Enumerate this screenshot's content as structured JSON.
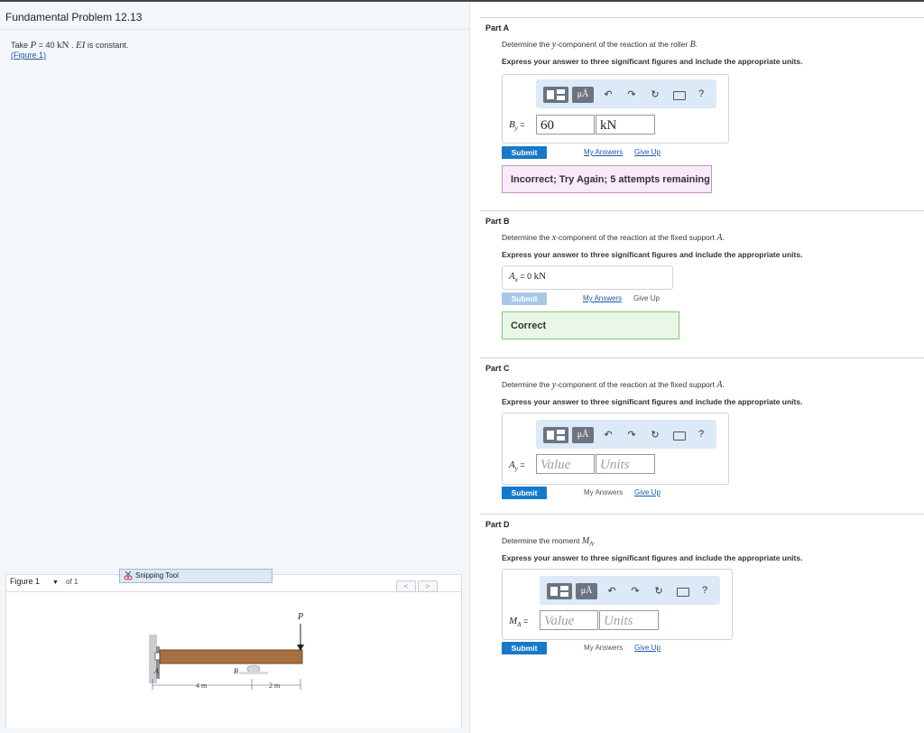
{
  "problem": {
    "title": "Fundamental Problem 12.13",
    "take": "Take",
    "p_var": "P",
    "p_eq": " = 40 ",
    "p_unit": "kN",
    "sep": " . ",
    "ei": "EI",
    "constant": " is constant.",
    "figure_link": "(Figure 1)"
  },
  "figure_panel": {
    "select_value": "Figure 1",
    "of_label": "of 1",
    "snipping_tool": "Snipping Tool",
    "prev": "<",
    "next": ">",
    "labels": {
      "p": "P",
      "a": "A",
      "b": "B",
      "dim1": "4 m",
      "dim2": "2 m"
    }
  },
  "toolbar": {
    "mu_label": "μÅ",
    "help": "?"
  },
  "common": {
    "instruction": "Express your answer to three significant figures and include the appropriate units.",
    "submit": "Submit",
    "my_answers": "My Answers",
    "give_up": "Give Up",
    "value_placeholder": "Value",
    "units_placeholder": "Units"
  },
  "partA": {
    "title": "Part A",
    "q_pre": "Determine the ",
    "q_var": "y",
    "q_post": "-component of the reaction at the roller ",
    "q_pt": "B",
    "q_end": ".",
    "label": "B",
    "label_sub": "y",
    "eq": " = ",
    "value": "60",
    "units": "kN",
    "feedback": "Incorrect; Try Again; 5 attempts remaining"
  },
  "partB": {
    "title": "Part B",
    "q_pre": "Determine the ",
    "q_var": "x",
    "q_post": "-component of the reaction at the fixed support ",
    "q_pt": "A",
    "q_end": ".",
    "label": "A",
    "label_sub": "x",
    "eq": " =  0 ",
    "units": "kN",
    "feedback": "Correct"
  },
  "partC": {
    "title": "Part C",
    "q_pre": "Determine the ",
    "q_var": "y",
    "q_post": "-component of the reaction at the fixed support ",
    "q_pt": "A",
    "q_end": ".",
    "label": "A",
    "label_sub": "y",
    "eq": " = "
  },
  "partD": {
    "title": "Part D",
    "q_pre": "Determine the moment ",
    "q_var": "M",
    "q_sub": "A",
    "q_end": ".",
    "label": "M",
    "label_sub": "A",
    "eq": " = "
  }
}
